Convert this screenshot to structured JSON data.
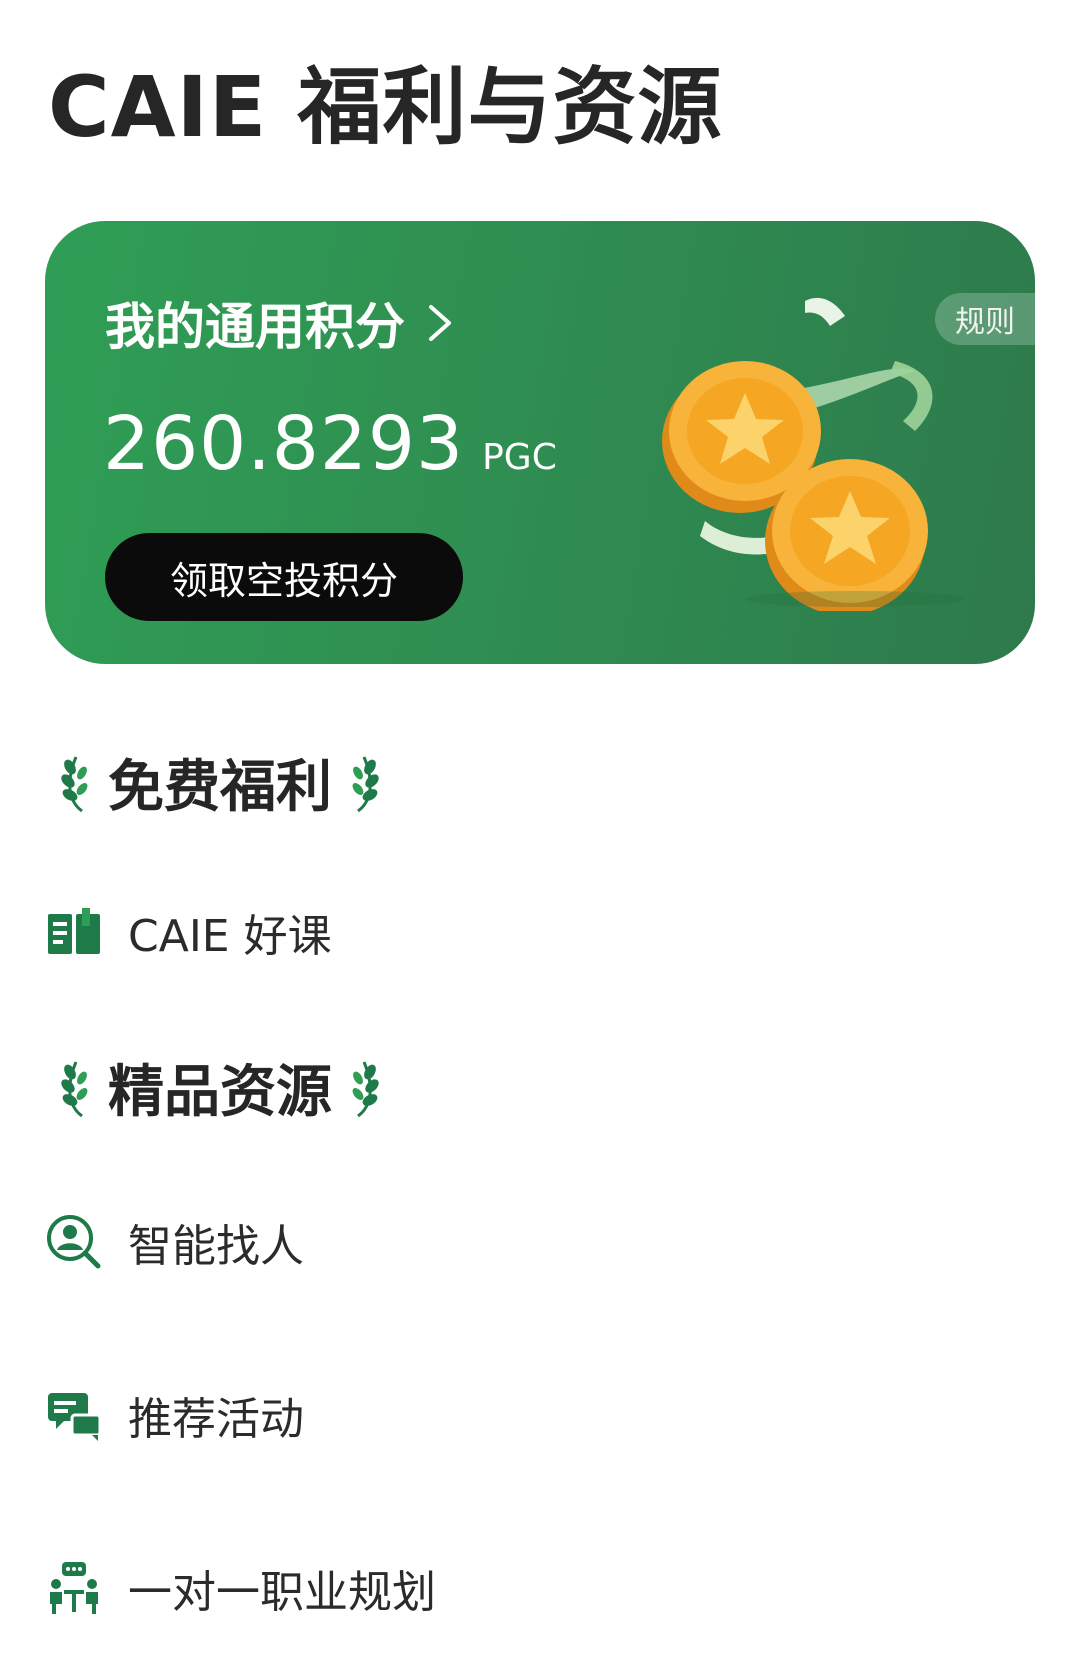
{
  "header": {
    "title": "CAIE 福利与资源"
  },
  "points_card": {
    "heading": "我的通用积分",
    "rules_label": "规则",
    "balance": "260.8293",
    "unit": "PGC",
    "airdrop_button_label": "领取空投积分"
  },
  "sections": {
    "free_benefits": {
      "title": "免费福利",
      "items": [
        {
          "label": "CAIE 好课",
          "icon": "book-icon"
        }
      ]
    },
    "premium_resources": {
      "title": "精品资源",
      "items": [
        {
          "label": "智能找人",
          "icon": "person-search-icon"
        },
        {
          "label": "推荐活动",
          "icon": "chat-bubbles-icon"
        },
        {
          "label": "一对一职业规划",
          "icon": "consultation-icon"
        }
      ]
    }
  },
  "colors": {
    "card_green": "#2f9e55",
    "icon_green": "#1f7a4a",
    "coin_gold": "#f5a623"
  }
}
